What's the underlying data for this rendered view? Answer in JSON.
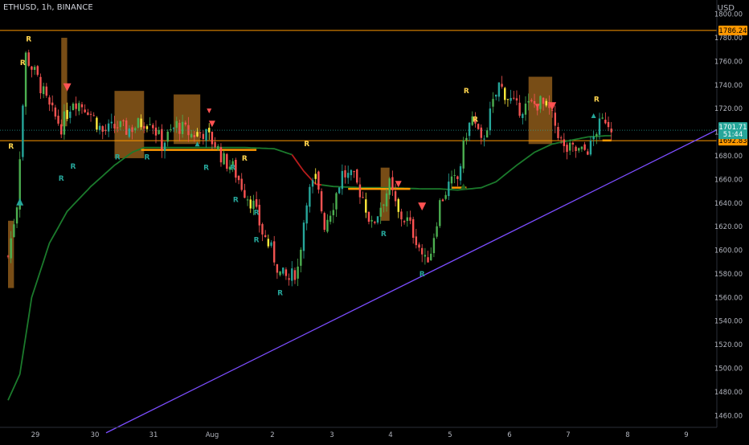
{
  "symbol": "ETHUSD, 1h, BINANCE",
  "currency": "USD",
  "colors": {
    "background": "#000000",
    "up": "#26a69a",
    "down": "#ef5350",
    "up_bright": "#4caf50",
    "down_bright": "#ff5252",
    "yellow": "#ffeb3b",
    "orange_level": "#ff9800",
    "ma_green": "#1b7a2c",
    "ma_red": "#b71c1c",
    "trendline": "#7c4dff",
    "zone_fill": "#8d5a1a",
    "signal_text": "#26a69a",
    "signal_text_sell": "#ffd54f",
    "axis_text": "#b2b5be",
    "current_price_bg": "#26a69a",
    "level_price_bg": "#ff9800"
  },
  "chart_data": {
    "type": "candlestick",
    "ylim": [
      1450,
      1812
    ],
    "x_ticks": [
      "29",
      "30",
      "31",
      "Aug",
      "2",
      "3",
      "4",
      "5",
      "6",
      "7",
      "8",
      "9"
    ],
    "y_ticks": [
      1460,
      1480,
      1500,
      1520,
      1540,
      1560,
      1580,
      1600,
      1620,
      1640,
      1660,
      1680,
      1700,
      1720,
      1740,
      1760,
      1780,
      1800
    ],
    "close_keyframes": [
      [
        0,
        1595
      ],
      [
        3,
        1640
      ],
      [
        6,
        1765
      ],
      [
        10,
        1745
      ],
      [
        14,
        1720
      ],
      [
        18,
        1705
      ],
      [
        22,
        1728
      ],
      [
        27,
        1720
      ],
      [
        32,
        1700
      ],
      [
        37,
        1705
      ],
      [
        40,
        1702
      ],
      [
        43,
        1705
      ],
      [
        48,
        1712
      ],
      [
        52,
        1690
      ],
      [
        57,
        1706
      ],
      [
        62,
        1698
      ],
      [
        66,
        1700
      ],
      [
        70,
        1690
      ],
      [
        73,
        1676
      ],
      [
        76,
        1670
      ],
      [
        80,
        1650
      ],
      [
        83,
        1638
      ],
      [
        86,
        1615
      ],
      [
        89,
        1600
      ],
      [
        92,
        1580
      ],
      [
        95,
        1575
      ],
      [
        98,
        1585
      ],
      [
        101,
        1645
      ],
      [
        104,
        1660
      ],
      [
        107,
        1622
      ],
      [
        110,
        1640
      ],
      [
        113,
        1665
      ],
      [
        117,
        1660
      ],
      [
        120,
        1645
      ],
      [
        123,
        1620
      ],
      [
        126,
        1638
      ],
      [
        129,
        1655
      ],
      [
        132,
        1630
      ],
      [
        135,
        1625
      ],
      [
        138,
        1610
      ],
      [
        141,
        1590
      ],
      [
        143,
        1600
      ],
      [
        146,
        1640
      ],
      [
        149,
        1655
      ],
      [
        152,
        1660
      ],
      [
        155,
        1700
      ],
      [
        157,
        1712
      ],
      [
        160,
        1690
      ],
      [
        163,
        1715
      ],
      [
        166,
        1740
      ],
      [
        169,
        1730
      ],
      [
        172,
        1720
      ],
      [
        176,
        1722
      ],
      [
        180,
        1725
      ],
      [
        183,
        1718
      ],
      [
        186,
        1700
      ],
      [
        188,
        1685
      ],
      [
        191,
        1685
      ],
      [
        194,
        1683
      ],
      [
        197,
        1688
      ],
      [
        199,
        1702
      ],
      [
        202,
        1712
      ],
      [
        204,
        1705
      ]
    ],
    "candle_count": 205,
    "horizontal_levels": [
      {
        "price": 1786.24,
        "label": "1786.24"
      },
      {
        "price": 1692.83,
        "label": "1692.83"
      }
    ],
    "current_price": {
      "price": 1701.71,
      "label": "1701.71",
      "countdown": "51:44"
    },
    "trendline": {
      "from": [
        "30",
        1446
      ],
      "to": [
        "9",
        1702
      ]
    },
    "moving_average_keyframes": [
      [
        0,
        1473
      ],
      [
        4,
        1495
      ],
      [
        8,
        1560
      ],
      [
        14,
        1606
      ],
      [
        20,
        1633
      ],
      [
        28,
        1654
      ],
      [
        36,
        1672
      ],
      [
        42,
        1683
      ],
      [
        46,
        1687
      ],
      [
        50,
        1687
      ],
      [
        60,
        1687
      ],
      [
        70,
        1687
      ],
      [
        80,
        1687
      ],
      [
        90,
        1686
      ],
      [
        96,
        1681
      ],
      [
        100,
        1667
      ],
      [
        104,
        1656
      ],
      [
        110,
        1654
      ],
      [
        120,
        1653
      ],
      [
        130,
        1653
      ],
      [
        140,
        1652
      ],
      [
        146,
        1652
      ],
      [
        152,
        1651
      ],
      [
        156,
        1652
      ],
      [
        160,
        1653
      ],
      [
        165,
        1658
      ],
      [
        172,
        1672
      ],
      [
        178,
        1683
      ],
      [
        184,
        1690
      ],
      [
        190,
        1693
      ],
      [
        196,
        1696
      ],
      [
        202,
        1697
      ],
      [
        204,
        1697
      ]
    ],
    "ma_red_range": [
      96,
      106
    ],
    "flat_segments": [
      {
        "from": 45,
        "to": 84,
        "price": 1685
      },
      {
        "from": 115,
        "to": 136,
        "price": 1652
      },
      {
        "from": 150,
        "to": 155,
        "price": 1653
      },
      {
        "from": 201,
        "to": 204,
        "price": 1693
      }
    ],
    "zones": [
      {
        "x0": 18,
        "x1": 20,
        "y0": 1705,
        "y1": 1780
      },
      {
        "x0": 36,
        "x1": 46,
        "y0": 1678,
        "y1": 1735
      },
      {
        "x0": 56,
        "x1": 65,
        "y0": 1690,
        "y1": 1732
      },
      {
        "x0": 126,
        "x1": 129,
        "y0": 1625,
        "y1": 1670
      },
      {
        "x0": 176,
        "x1": 184,
        "y0": 1690,
        "y1": 1747
      },
      {
        "x0": 0,
        "x1": 2,
        "y0": 1568,
        "y1": 1625
      }
    ],
    "signals": [
      {
        "text": "R",
        "i": 7,
        "price": 1777,
        "color": "yellow"
      },
      {
        "text": "R",
        "i": 5,
        "price": 1757,
        "color": "yellow"
      },
      {
        "text": "R",
        "i": 1,
        "price": 1686,
        "color": "yellow"
      },
      {
        "text": "R",
        "i": 22,
        "price": 1669,
        "color": "teal"
      },
      {
        "text": "R",
        "i": 18,
        "price": 1659,
        "color": "teal"
      },
      {
        "text": "R",
        "i": 37,
        "price": 1677,
        "color": "teal"
      },
      {
        "text": "R",
        "i": 47,
        "price": 1677,
        "color": "teal"
      },
      {
        "text": "R",
        "i": 67,
        "price": 1668,
        "color": "teal"
      },
      {
        "text": "R",
        "i": 76,
        "price": 1668,
        "color": "teal"
      },
      {
        "text": "R",
        "i": 80,
        "price": 1676,
        "color": "yellow"
      },
      {
        "text": "R",
        "i": 77,
        "price": 1641,
        "color": "teal"
      },
      {
        "text": "R",
        "i": 84,
        "price": 1630,
        "color": "teal"
      },
      {
        "text": "R",
        "i": 84,
        "price": 1607,
        "color": "teal"
      },
      {
        "text": "R",
        "i": 92,
        "price": 1562,
        "color": "teal"
      },
      {
        "text": "R",
        "i": 101,
        "price": 1688,
        "color": "yellow"
      },
      {
        "text": "R",
        "i": 127,
        "price": 1612,
        "color": "teal"
      },
      {
        "text": "R",
        "i": 140,
        "price": 1578,
        "color": "teal"
      },
      {
        "text": "R",
        "i": 155,
        "price": 1733,
        "color": "yellow"
      },
      {
        "text": "R",
        "i": 158,
        "price": 1709,
        "color": "yellow"
      },
      {
        "text": "R",
        "i": 199,
        "price": 1726,
        "color": "yellow"
      }
    ],
    "markers": [
      {
        "kind": "down",
        "i": 20,
        "price": 1738,
        "size": 10,
        "color": "#ff5252"
      },
      {
        "kind": "up",
        "i": 4,
        "price": 1641,
        "size": 9,
        "color": "#26a69a"
      },
      {
        "kind": "down",
        "i": 68,
        "price": 1718,
        "size": 6,
        "color": "#ff5252"
      },
      {
        "kind": "down",
        "i": 69,
        "price": 1707,
        "size": 8,
        "color": "#ff5252"
      },
      {
        "kind": "up",
        "i": 64,
        "price": 1690,
        "size": 6,
        "color": "#26a69a"
      },
      {
        "kind": "down",
        "i": 132,
        "price": 1656,
        "size": 8,
        "color": "#ff5252"
      },
      {
        "kind": "down",
        "i": 140,
        "price": 1637,
        "size": 10,
        "color": "#ff5252"
      },
      {
        "kind": "up",
        "i": 154,
        "price": 1654,
        "size": 8,
        "color": "#1b5e20"
      },
      {
        "kind": "down",
        "i": 179,
        "price": 1722,
        "size": 6,
        "color": "#ff5252"
      },
      {
        "kind": "down",
        "i": 184,
        "price": 1722,
        "size": 10,
        "color": "#ff5252"
      },
      {
        "kind": "up",
        "i": 198,
        "price": 1714,
        "size": 6,
        "color": "#26a69a"
      }
    ]
  }
}
